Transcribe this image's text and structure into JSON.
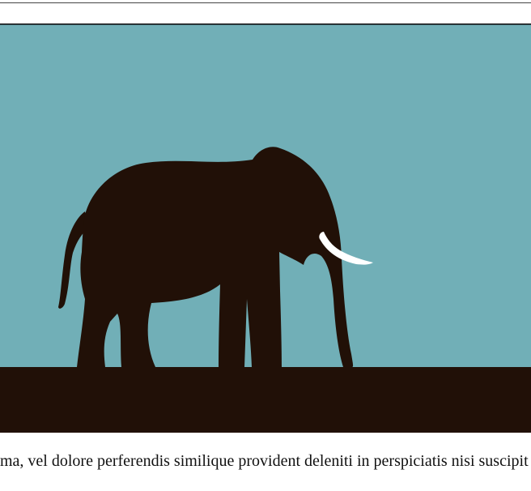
{
  "body": {
    "paragraph_text": "ma, vel dolore perferendis similique provident deleniti in perspiciatis nisi suscipit"
  },
  "image": {
    "icon": "elephant-silhouette-icon",
    "colors": {
      "sky": "#71afb7",
      "ground": "#211007",
      "silhouette": "#211007",
      "tusk": "#ffffff",
      "frame_border": "#111111"
    }
  }
}
